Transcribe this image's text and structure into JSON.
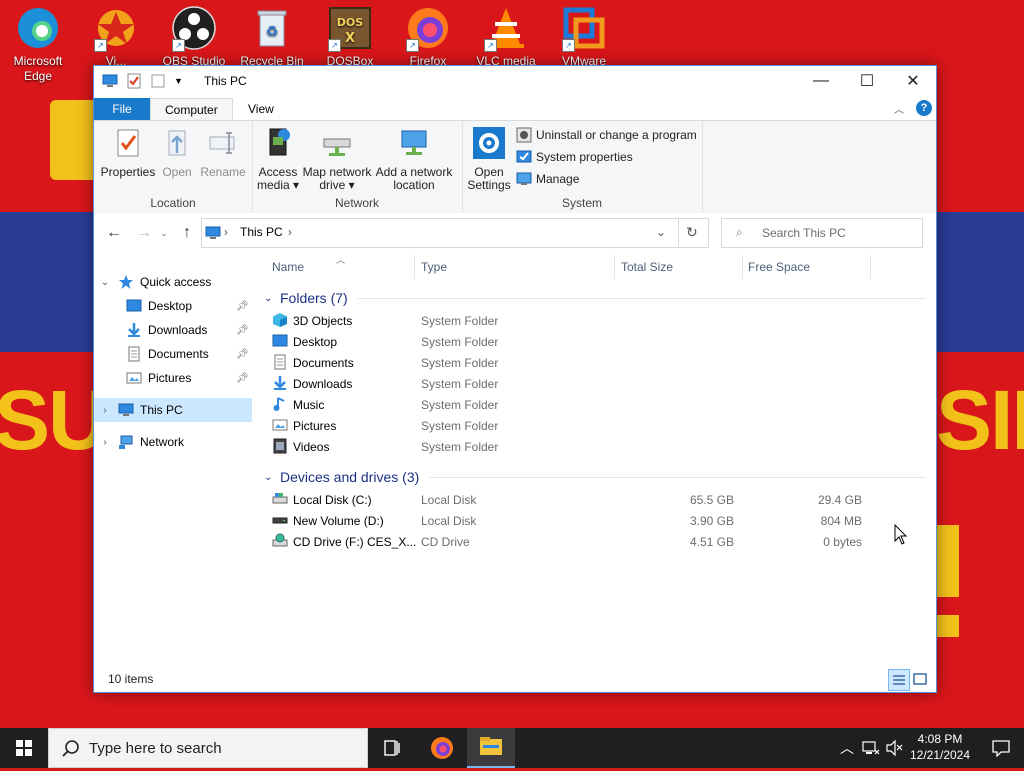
{
  "desktop": {
    "icons": [
      {
        "label": "Microsoft Edge"
      },
      {
        "label": "Vi..."
      },
      {
        "label": "OBS Studio"
      },
      {
        "label": "Recycle Bin"
      },
      {
        "label": "DOSBox"
      },
      {
        "label": "Firefox"
      },
      {
        "label": "VLC media"
      },
      {
        "label": "VMware"
      }
    ],
    "wallpaper_text_left": "SUI",
    "wallpaper_text_right": "SIN",
    "colors": {
      "red": "#d9161a",
      "blue": "#2a3c96",
      "yellow": "#f2c21b"
    }
  },
  "window": {
    "title": "This PC",
    "controls": {
      "minimize": "—",
      "maximize": "☐",
      "close": "✕"
    },
    "ribbon_tabs": [
      "File",
      "Computer",
      "View"
    ],
    "ribbon": {
      "location": {
        "label": "Location",
        "buttons": [
          "Properties",
          "Open",
          "Rename"
        ]
      },
      "network": {
        "label": "Network",
        "access_media": [
          "Access",
          "media ▾"
        ],
        "map_drive": [
          "Map network",
          "drive ▾"
        ],
        "add_location": [
          "Add a network",
          "location"
        ]
      },
      "system": {
        "label": "System",
        "open_settings": [
          "Open",
          "Settings"
        ],
        "uninstall": "Uninstall or change a program",
        "system_properties": "System properties",
        "manage": "Manage"
      }
    },
    "address": {
      "path": "This PC"
    },
    "search": {
      "placeholder": "Search This PC"
    },
    "nav": {
      "quick_access": "Quick access",
      "quick_items": [
        "Desktop",
        "Downloads",
        "Documents",
        "Pictures"
      ],
      "this_pc": "This PC",
      "network": "Network"
    },
    "columns": [
      "Name",
      "Type",
      "Total Size",
      "Free Space"
    ],
    "folders_group": "Folders (7)",
    "folders": [
      {
        "name": "3D Objects",
        "type": "System Folder"
      },
      {
        "name": "Desktop",
        "type": "System Folder"
      },
      {
        "name": "Documents",
        "type": "System Folder"
      },
      {
        "name": "Downloads",
        "type": "System Folder"
      },
      {
        "name": "Music",
        "type": "System Folder"
      },
      {
        "name": "Pictures",
        "type": "System Folder"
      },
      {
        "name": "Videos",
        "type": "System Folder"
      }
    ],
    "drives_group": "Devices and drives (3)",
    "drives": [
      {
        "name": "Local Disk (C:)",
        "type": "Local Disk",
        "total": "65.5 GB",
        "free": "29.4 GB"
      },
      {
        "name": "New Volume (D:)",
        "type": "Local Disk",
        "total": "3.90 GB",
        "free": "804 MB"
      },
      {
        "name": "CD Drive (F:) CES_X...",
        "type": "CD Drive",
        "total": "4.51 GB",
        "free": "0 bytes"
      }
    ],
    "status": {
      "count": "10 items"
    }
  },
  "taskbar": {
    "search_placeholder": "Type here to search",
    "time": "4:08 PM",
    "date": "12/21/2024"
  }
}
